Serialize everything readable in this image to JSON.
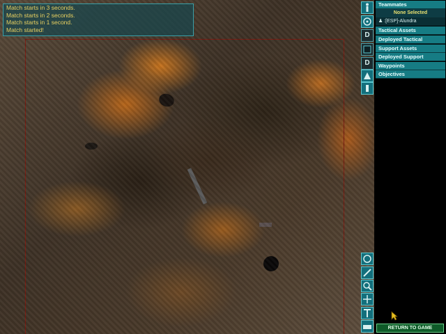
{
  "chat": {
    "messages": [
      "Match starts in 3 seconds.",
      "Match starts in 2 seconds.",
      "Match starts in 1 second.",
      "Match started!"
    ]
  },
  "top_tools": [
    {
      "icon": "player-figure-icon",
      "label": ""
    },
    {
      "icon": "sensor-circle-icon",
      "label": ""
    },
    {
      "icon": "deploy-icon",
      "label": "D"
    },
    {
      "icon": "vehicle-icon",
      "label": ""
    },
    {
      "icon": "deploy-icon",
      "label": "D"
    },
    {
      "icon": "turret-icon",
      "label": ""
    },
    {
      "icon": "flag-icon",
      "label": ""
    }
  ],
  "bottom_tools": [
    {
      "icon": "compass-icon"
    },
    {
      "icon": "zoom-out-icon"
    },
    {
      "icon": "zoom-in-icon"
    },
    {
      "icon": "center-icon"
    },
    {
      "icon": "text-label-icon"
    },
    {
      "icon": "camera-icon"
    }
  ],
  "panel": {
    "teammates_header": "Teammates",
    "none_selected": "None Selected",
    "member": ":[ESP]-Alundra",
    "sections": [
      "Tactical Assets",
      "Deployed Tactical",
      "Support Assets",
      "Deployed Support",
      "Waypoints",
      "Objectives"
    ],
    "return_button": "RETURN TO GAME"
  },
  "colors": {
    "panel_header": "#167c84",
    "chat_text": "#e8d060",
    "return_button": "#0e5a28"
  }
}
